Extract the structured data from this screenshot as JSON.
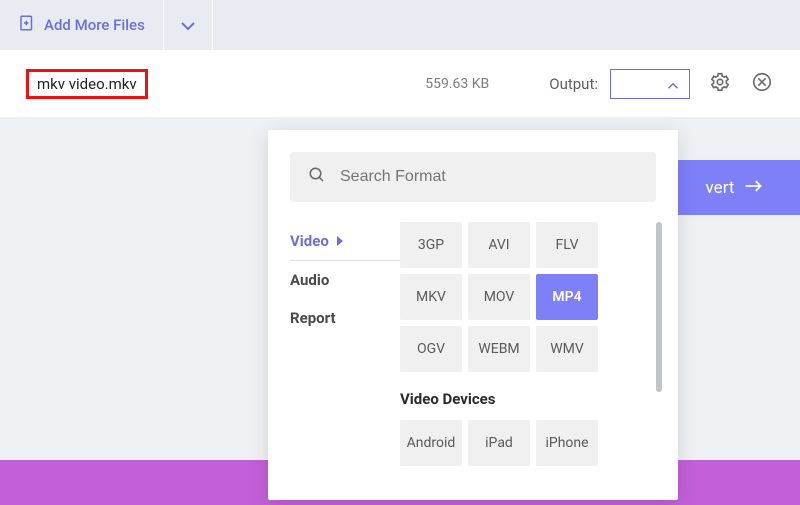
{
  "topbar": {
    "add_label": "Add More Files"
  },
  "file": {
    "name": "mkv video.mkv",
    "size": "559.63 KB",
    "output_label": "Output:"
  },
  "actions": {
    "convert": "vert"
  },
  "picker": {
    "search_placeholder": "Search Format",
    "categories": {
      "video": "Video",
      "audio": "Audio",
      "report": "Report"
    },
    "video_formats": [
      "3GP",
      "AVI",
      "FLV",
      "MKV",
      "MOV",
      "MP4",
      "OGV",
      "WEBM",
      "WMV"
    ],
    "selected": "MP4",
    "devices_heading": "Video Devices",
    "devices": [
      "Android",
      "iPad",
      "iPhone"
    ]
  }
}
